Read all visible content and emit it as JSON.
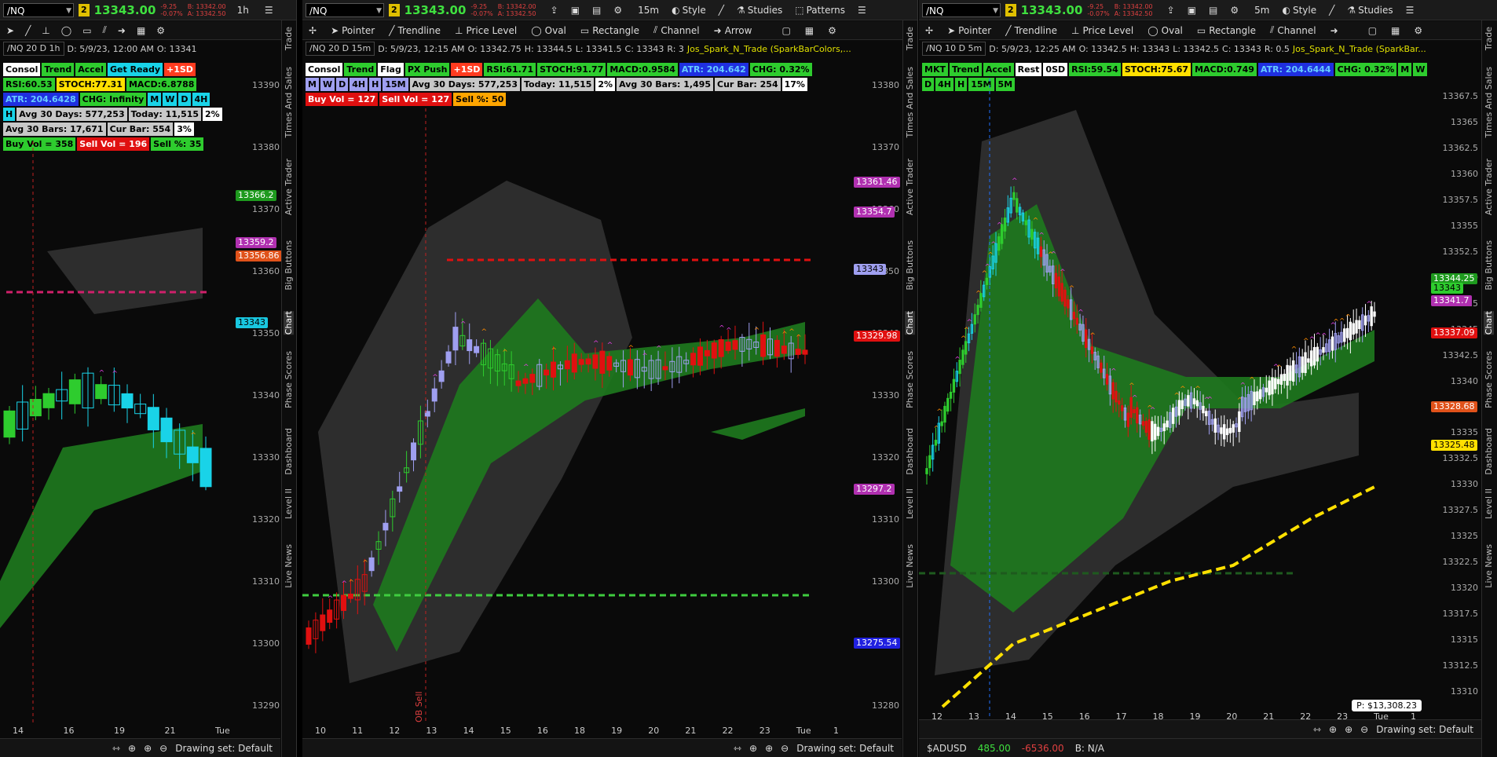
{
  "common": {
    "symbol": "/NQ",
    "badge": "2",
    "last": "13343.00",
    "change_pts": "-9.25",
    "change_pct": "-0.07%",
    "bid": "B: 13342.00",
    "ask": "A: 13342.50",
    "drawing_set": "Drawing set: Default"
  },
  "side_tabs": [
    "Trade",
    "Times And Sales",
    "Active Trader",
    "Big Buttons",
    "Chart",
    "Phase Scores",
    "Dashboard",
    "Level II",
    "Live News"
  ],
  "panel1": {
    "timeframe": "1h",
    "title": "/NQ 20 D 1h",
    "date": "D: 5/9/23, 12:00 AM",
    "ohlc": "O: 13341",
    "chips": [
      {
        "t": "Consol",
        "bg": "#ffffff",
        "fg": "#000"
      },
      {
        "t": "Trend",
        "bg": "#2ecc2e",
        "fg": "#000"
      },
      {
        "t": "Accel",
        "bg": "#2ecc2e",
        "fg": "#000"
      },
      {
        "t": "Get Ready",
        "bg": "#19d3e8",
        "fg": "#000"
      },
      {
        "t": "+1SD",
        "bg": "#ff3b1f",
        "fg": "#fff"
      },
      {
        "t": "RSI:60.53",
        "bg": "#2ecc2e",
        "fg": "#000"
      },
      {
        "t": "STOCH:77.31",
        "bg": "#ffe000",
        "fg": "#000"
      },
      {
        "t": "MACD:6.8788",
        "bg": "#2ecc2e",
        "fg": "#000"
      },
      {
        "t": "ATR: 204.6428",
        "bg": "#1f2fe0",
        "fg": "#6cf"
      },
      {
        "t": "CHG: Infinity",
        "bg": "#2ecc2e",
        "fg": "#000"
      },
      {
        "t": "M",
        "bg": "#19d3e8",
        "fg": "#000"
      },
      {
        "t": "W",
        "bg": "#19d3e8",
        "fg": "#000"
      },
      {
        "t": "D",
        "bg": "#19d3e8",
        "fg": "#000"
      },
      {
        "t": "4H",
        "bg": "#19d3e8",
        "fg": "#000"
      },
      {
        "t": "H",
        "bg": "#19d3e8",
        "fg": "#000"
      },
      {
        "t": "Avg 30 Days: 577,253",
        "bg": "#c8c8c8",
        "fg": "#000"
      },
      {
        "t": "Today: 11,515",
        "bg": "#c8c8c8",
        "fg": "#000"
      },
      {
        "t": "2%",
        "bg": "#ffffff",
        "fg": "#000"
      },
      {
        "t": "Avg 30 Bars: 17,671",
        "bg": "#c8c8c8",
        "fg": "#000"
      },
      {
        "t": "Cur Bar: 554",
        "bg": "#c8c8c8",
        "fg": "#000"
      },
      {
        "t": "3%",
        "bg": "#ffffff",
        "fg": "#000"
      },
      {
        "t": "Buy Vol = 358",
        "bg": "#2ecc2e",
        "fg": "#000"
      },
      {
        "t": "Sell Vol = 196",
        "bg": "#e01010",
        "fg": "#fff"
      },
      {
        "t": "Sell %: 35",
        "bg": "#2ecc2e",
        "fg": "#000"
      }
    ],
    "yticks": [
      "13390",
      "13380",
      "13370",
      "13360",
      "13350",
      "13340",
      "13330",
      "13320",
      "13310",
      "13300",
      "13290"
    ],
    "ytags": [
      {
        "t": "13366.2",
        "bg": "#1e9a1e"
      },
      {
        "t": "13359.2",
        "bg": "#b030b0"
      },
      {
        "t": "13356.86",
        "bg": "#e0521a"
      },
      {
        "t": "13343",
        "bg": "#19c7e0"
      }
    ],
    "xlabels": [
      "14",
      "16",
      "19",
      "21",
      "Tue"
    ]
  },
  "panel2": {
    "timeframe": "15m",
    "title": "/NQ 20 D 15m",
    "date": "D: 5/9/23, 12:15 AM",
    "o": "O: 13342.75",
    "h": "H: 13344.5",
    "l": "L: 13341.5",
    "c": "C: 13343",
    "r": "R: 3",
    "study": "Jos_Spark_N_Trade (SparkBarColors,...",
    "chips": [
      {
        "t": "Consol",
        "bg": "#ffffff",
        "fg": "#000"
      },
      {
        "t": "Trend",
        "bg": "#2ecc2e",
        "fg": "#000"
      },
      {
        "t": "Flag",
        "bg": "#ffffff",
        "fg": "#000"
      },
      {
        "t": "PX Push",
        "bg": "#2ecc2e",
        "fg": "#000"
      },
      {
        "t": "+1SD",
        "bg": "#ff3b1f",
        "fg": "#fff"
      },
      {
        "t": "RSI:61.71",
        "bg": "#2ecc2e",
        "fg": "#000"
      },
      {
        "t": "STOCH:91.77",
        "bg": "#2ecc2e",
        "fg": "#000"
      },
      {
        "t": "MACD:0.9584",
        "bg": "#2ecc2e",
        "fg": "#000"
      },
      {
        "t": "ATR: 204.642",
        "bg": "#1f2fe0",
        "fg": "#6cf"
      },
      {
        "t": "CHG: 0.32%",
        "bg": "#2ecc2e",
        "fg": "#000"
      },
      {
        "t": "M",
        "bg": "#9f9ff0",
        "fg": "#000"
      },
      {
        "t": "W",
        "bg": "#9f9ff0",
        "fg": "#000"
      },
      {
        "t": "D",
        "bg": "#9f9ff0",
        "fg": "#000"
      },
      {
        "t": "4H",
        "bg": "#9f9ff0",
        "fg": "#000"
      },
      {
        "t": "H",
        "bg": "#9f9ff0",
        "fg": "#000"
      },
      {
        "t": "15M",
        "bg": "#9f9ff0",
        "fg": "#000"
      },
      {
        "t": "Avg 30 Days: 577,253",
        "bg": "#c8c8c8",
        "fg": "#000"
      },
      {
        "t": "Today: 11,515",
        "bg": "#c8c8c8",
        "fg": "#000"
      },
      {
        "t": "2%",
        "bg": "#ffffff",
        "fg": "#000"
      },
      {
        "t": "Avg 30 Bars: 1,495",
        "bg": "#c8c8c8",
        "fg": "#000"
      },
      {
        "t": "Cur Bar: 254",
        "bg": "#c8c8c8",
        "fg": "#000"
      },
      {
        "t": "17%",
        "bg": "#ffffff",
        "fg": "#000"
      },
      {
        "t": "Buy Vol = 127",
        "bg": "#e01010",
        "fg": "#fff"
      },
      {
        "t": "Sell Vol = 127",
        "bg": "#e01010",
        "fg": "#fff"
      },
      {
        "t": "Sell %: 50",
        "bg": "#ffa500",
        "fg": "#000"
      }
    ],
    "yticks": [
      "13380",
      "13370",
      "13360",
      "13350",
      "13340",
      "13330",
      "13320",
      "13310",
      "13300",
      "13290",
      "13280"
    ],
    "ytags": [
      {
        "t": "13361.46",
        "bg": "#b030b0"
      },
      {
        "t": "13354.7",
        "bg": "#b030b0"
      },
      {
        "t": "13343",
        "bg": "#9f9ff0"
      },
      {
        "t": "13329.98",
        "bg": "#e01010"
      },
      {
        "t": "13297.2",
        "bg": "#b030b0"
      },
      {
        "t": "13275.54",
        "bg": "#2020e0"
      }
    ],
    "xlabels": [
      "10",
      "11",
      "12",
      "13",
      "14",
      "15",
      "16",
      "18",
      "19",
      "20",
      "21",
      "22",
      "23",
      "Tue",
      "1"
    ],
    "annot": "OB Sell"
  },
  "panel3": {
    "timeframe": "5m",
    "title": "/NQ 10 D 5m",
    "date": "D: 5/9/23, 12:25 AM",
    "o": "O: 13342.5",
    "h": "H: 13343",
    "l": "L: 13342.5",
    "c": "C: 13343",
    "r": "R: 0.5",
    "study": "Jos_Spark_N_Trade (SparkBar...",
    "chips": [
      {
        "t": "MKT",
        "bg": "#2ecc2e",
        "fg": "#000"
      },
      {
        "t": "Trend",
        "bg": "#2ecc2e",
        "fg": "#000"
      },
      {
        "t": "Accel",
        "bg": "#2ecc2e",
        "fg": "#000"
      },
      {
        "t": "Rest",
        "bg": "#ffffff",
        "fg": "#000"
      },
      {
        "t": "0SD",
        "bg": "#ffffff",
        "fg": "#000"
      },
      {
        "t": "RSI:59.54",
        "bg": "#2ecc2e",
        "fg": "#000"
      },
      {
        "t": "STOCH:75.67",
        "bg": "#ffe000",
        "fg": "#000"
      },
      {
        "t": "MACD:0.749",
        "bg": "#2ecc2e",
        "fg": "#000"
      },
      {
        "t": "ATR: 204.6444",
        "bg": "#1f2fe0",
        "fg": "#6cf"
      },
      {
        "t": "CHG: 0.32%",
        "bg": "#2ecc2e",
        "fg": "#000"
      },
      {
        "t": "M",
        "bg": "#2ecc2e",
        "fg": "#000"
      },
      {
        "t": "W",
        "bg": "#2ecc2e",
        "fg": "#000"
      },
      {
        "t": "D",
        "bg": "#2ecc2e",
        "fg": "#000"
      },
      {
        "t": "4H",
        "bg": "#2ecc2e",
        "fg": "#000"
      },
      {
        "t": "H",
        "bg": "#2ecc2e",
        "fg": "#000"
      },
      {
        "t": "15M",
        "bg": "#2ecc2e",
        "fg": "#000"
      },
      {
        "t": "5M",
        "bg": "#2ecc2e",
        "fg": "#000"
      }
    ],
    "yticks": [
      "13367.5",
      "13365",
      "13362.5",
      "13360",
      "13357.5",
      "13355",
      "13352.5",
      "13350",
      "13347.5",
      "13345",
      "13342.5",
      "13340",
      "13337.5",
      "13335",
      "13332.5",
      "13330",
      "13327.5",
      "13325",
      "13322.5",
      "13320",
      "13317.5",
      "13315",
      "13312.5",
      "13310"
    ],
    "ytags": [
      {
        "t": "13344.25",
        "bg": "#1e9a1e"
      },
      {
        "t": "13343",
        "bg": "#2ecc2e"
      },
      {
        "t": "13341.7",
        "bg": "#b030b0"
      },
      {
        "t": "13337.09",
        "bg": "#e01010"
      },
      {
        "t": "13328.68",
        "bg": "#e0521a"
      },
      {
        "t": "13325.48",
        "bg": "#ffe000"
      }
    ],
    "xlabels": [
      "12",
      "13",
      "14",
      "15",
      "16",
      "17",
      "18",
      "19",
      "20",
      "21",
      "22",
      "23",
      "Tue",
      "1"
    ],
    "pbox": "P: $13,308.23",
    "bottom_symbol": "$ADUSD",
    "bottom_vals": [
      "485.00",
      "-6536.00",
      "B: N/A"
    ]
  },
  "toolbar": {
    "pointer": "Pointer",
    "trendline": "Trendline",
    "price_level": "Price Level",
    "oval": "Oval",
    "rectangle": "Rectangle",
    "channel": "Channel",
    "arrow": "Arrow",
    "style": "Style",
    "studies": "Studies",
    "patterns": "Patterns"
  }
}
